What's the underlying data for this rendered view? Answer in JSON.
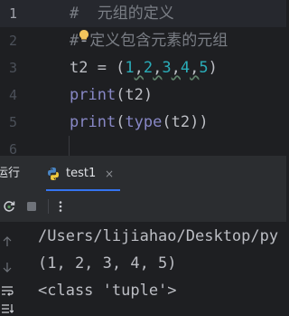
{
  "editor": {
    "lines": [
      {
        "num": "1",
        "current": true,
        "tokens": [
          {
            "t": "#  元组的定义",
            "c": "comment"
          }
        ]
      },
      {
        "num": "2",
        "current": false,
        "tokens": [
          {
            "t": "#",
            "c": "comment"
          },
          {
            "t": "",
            "c": "bulb"
          },
          {
            "t": "定义包含元素的元组",
            "c": "comment"
          }
        ]
      },
      {
        "num": "3",
        "current": false,
        "tokens": [
          {
            "t": "t2 = (",
            "c": "ident"
          },
          {
            "t": "1",
            "c": "num"
          },
          {
            "t": ",",
            "c": "comma"
          },
          {
            "t": "2",
            "c": "num"
          },
          {
            "t": ",",
            "c": "comma"
          },
          {
            "t": "3",
            "c": "num"
          },
          {
            "t": ",",
            "c": "comma"
          },
          {
            "t": "4",
            "c": "num"
          },
          {
            "t": ",",
            "c": "comma"
          },
          {
            "t": "5",
            "c": "num"
          },
          {
            "t": ")",
            "c": "op"
          }
        ]
      },
      {
        "num": "4",
        "current": false,
        "tokens": [
          {
            "t": "print",
            "c": "builtin"
          },
          {
            "t": "(t2)",
            "c": "ident"
          }
        ]
      },
      {
        "num": "5",
        "current": false,
        "tokens": [
          {
            "t": "print",
            "c": "builtin"
          },
          {
            "t": "(",
            "c": "op"
          },
          {
            "t": "type",
            "c": "builtin"
          },
          {
            "t": "(t2))",
            "c": "ident"
          }
        ]
      },
      {
        "num": "6",
        "current": false,
        "tokens": []
      }
    ]
  },
  "run_panel": {
    "title": "运行",
    "tab_label": "test1",
    "tab_close": "×",
    "toolbar": {
      "rerun_icon": "rerun-icon",
      "stop_icon": "stop-icon",
      "more_icon": "more-vertical-icon"
    },
    "gutter_icons": [
      "arrow-up-icon",
      "arrow-down-icon",
      "soft-wrap-icon",
      "scroll-to-end-icon"
    ],
    "output": [
      "/Users/lijiahao/Desktop/py",
      "(1, 2, 3, 4, 5)",
      "<class 'tuple'>"
    ]
  },
  "colors": {
    "background": "#1e1f22",
    "comment": "#7a7e85",
    "number": "#2aacb8",
    "builtin": "#8888c6",
    "accent": "#3574f0"
  }
}
